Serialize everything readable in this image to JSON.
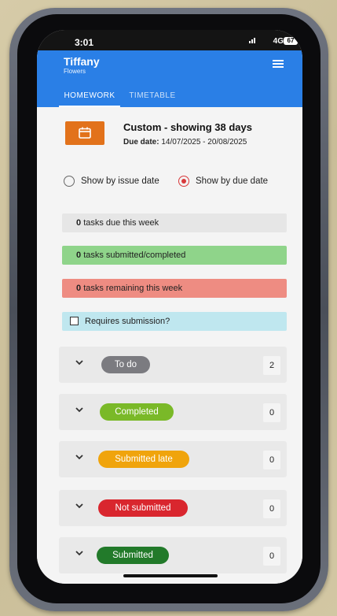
{
  "status": {
    "time": "3:01",
    "network": "4G",
    "battery": "67"
  },
  "app": {
    "title": "Tiffany",
    "subtitle": "Flowers"
  },
  "tabs": [
    {
      "label": "HOMEWORK"
    },
    {
      "label": "TIMETABLE"
    }
  ],
  "range": {
    "title": "Custom - showing 38 days",
    "due_label": "Due date:",
    "due_value": "14/07/2025 - 20/08/2025"
  },
  "sort_options": [
    {
      "label": "Show by issue date",
      "selected": false
    },
    {
      "label": "Show by due date",
      "selected": true
    }
  ],
  "stats": {
    "due_week": {
      "count": "0",
      "text": "tasks due this week"
    },
    "submitted": {
      "count": "0",
      "text": "tasks submitted/completed"
    },
    "remaining": {
      "count": "0",
      "text": "tasks remaining this week"
    }
  },
  "filter": {
    "label": "Requires submission?",
    "checked": false
  },
  "groups": [
    {
      "label": "To do",
      "count": "2",
      "color": "#7b7b80"
    },
    {
      "label": "Completed",
      "count": "0",
      "color": "#7ab928"
    },
    {
      "label": "Submitted late",
      "count": "0",
      "color": "#f0a40c"
    },
    {
      "label": "Not submitted",
      "count": "0",
      "color": "#d9262e"
    },
    {
      "label": "Submitted",
      "count": "0",
      "color": "#227a2a"
    }
  ],
  "colors": {
    "app_bar": "#2a7fe6",
    "calendar_button": "#e2721b"
  }
}
